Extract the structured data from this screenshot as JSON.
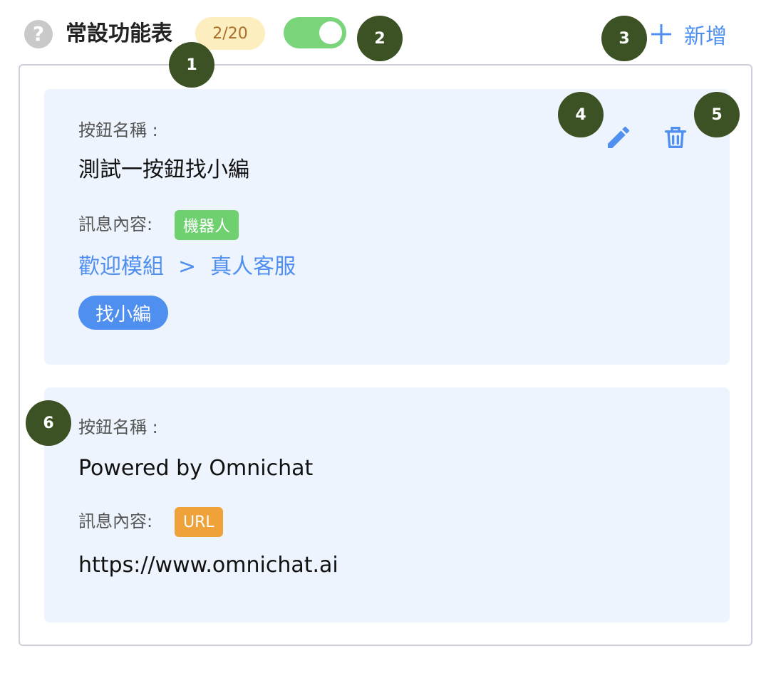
{
  "header": {
    "title": "常設功能表",
    "count": "2/20",
    "add_label": "新增",
    "toggle_on": true
  },
  "icons": {
    "help": "question-circle-icon",
    "add": "plus-icon",
    "edit": "pencil-icon",
    "delete": "trash-icon"
  },
  "cards": [
    {
      "name_label": "按鈕名稱 :",
      "name_value": "測試一按鈕找小編",
      "message_label": "訊息內容:",
      "message_type": "機器人",
      "flow_module": "歡迎模組",
      "flow_separator": ">",
      "flow_target": "真人客服",
      "pill": "找小編"
    },
    {
      "name_label": "按鈕名稱 :",
      "name_value": "Powered by Omnichat",
      "message_label": "訊息內容:",
      "message_type": "URL",
      "url": "https://www.omnichat.ai"
    }
  ],
  "markers": [
    "1",
    "2",
    "3",
    "4",
    "5",
    "6"
  ],
  "colors": {
    "accent": "#4f8ff0",
    "toggle_on": "#7ad47a",
    "badge_bg": "#fdeec0",
    "card_bg": "#eef4fd",
    "tag_robot": "#6fd06f",
    "tag_url": "#f0a23a",
    "marker": "#3c5225"
  }
}
